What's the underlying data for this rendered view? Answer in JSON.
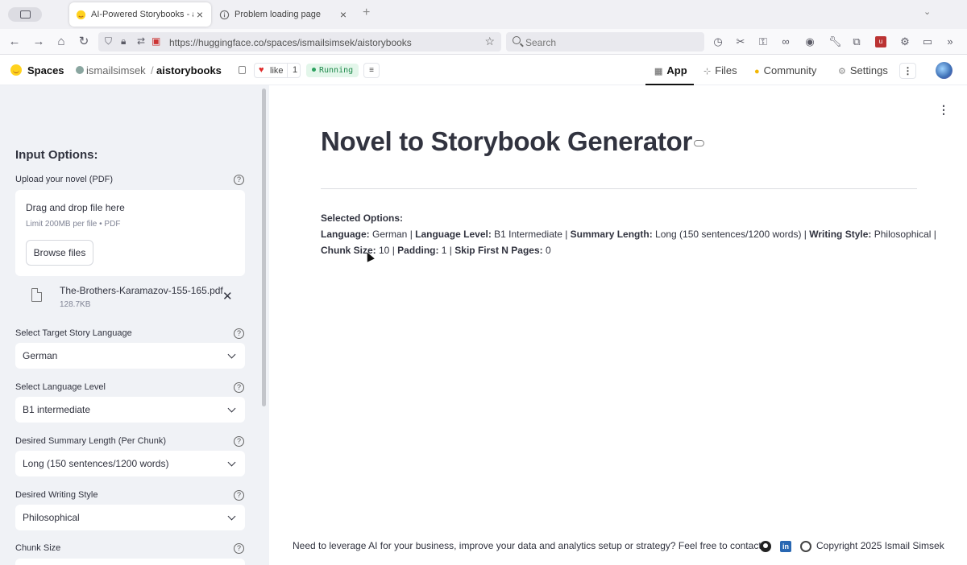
{
  "browser": {
    "tabs": [
      {
        "title": "AI-Powered Storybooks - a Hugg",
        "active": true
      },
      {
        "title": "Problem loading page",
        "active": false
      }
    ],
    "new_tab": "+",
    "url": "https://huggingface.co/spaces/ismailsimsek/aistorybooks",
    "search_placeholder": "Search",
    "icons": [
      "tab-overview-icon",
      "back-icon",
      "forward-icon",
      "home-icon",
      "reload-icon",
      "shield-icon",
      "lock-icon",
      "permissions-icon",
      "bookmark-star-icon",
      "history-icon",
      "screenshot-icon",
      "password-key-icon",
      "reader-mask-icon",
      "account-icon",
      "wrench-icon",
      "extensions-icon",
      "ublock-icon",
      "settings-gear-icon",
      "sidebar-icon",
      "overflow-menu-icon"
    ]
  },
  "hf": {
    "spaces_label": "Spaces",
    "owner": "ismailsimsek",
    "separator": "/",
    "repo": "aistorybooks",
    "like_label": "like",
    "like_count": "1",
    "status": "Running",
    "tabs": [
      {
        "label": "App",
        "icon": "app-icon",
        "active": true
      },
      {
        "label": "Files",
        "icon": "files-icon",
        "active": false
      },
      {
        "label": "Community",
        "icon": "community-icon",
        "active": false
      },
      {
        "label": "Settings",
        "icon": "settings-icon",
        "active": false
      }
    ]
  },
  "sidebar": {
    "heading": "Input Options:",
    "upload": {
      "label": "Upload your novel (PDF)",
      "drag_text": "Drag and drop file here",
      "limit_text": "Limit 200MB per file • PDF",
      "browse_label": "Browse files",
      "file_name": "The-Brothers-Karamazov-155-165.pdf",
      "file_size": "128.7KB"
    },
    "selects": [
      {
        "label": "Select Target Story Language",
        "value": "German"
      },
      {
        "label": "Select Language Level",
        "value": "B1 intermediate"
      },
      {
        "label": "Desired Summary Length (Per Chunk)",
        "value": "Long (150 sentences/1200 words)"
      },
      {
        "label": "Desired Writing Style",
        "value": "Philosophical"
      }
    ],
    "chunk_label": "Chunk Size"
  },
  "main": {
    "title": "Novel to Storybook Generator",
    "selected_heading": "Selected Options:",
    "options": {
      "language_k": "Language:",
      "language_v": " German | ",
      "level_k": "Language Level:",
      "level_v": " B1 Intermediate | ",
      "length_k": "Summary Length:",
      "length_v": " Long (150 sentences/1200 words) | ",
      "style_k": "Writing Style:",
      "style_v": " Philosophical |",
      "chunk_k": "Chunk Size:",
      "chunk_v": " 10 | ",
      "padding_k": "Padding:",
      "padding_v": " 1 | ",
      "skip_k": "Skip First N Pages:",
      "skip_v": " 0"
    },
    "footer_text": "Need to leverage AI for your business, improve your data and analytics setup or strategy? Feel free to contact.",
    "copyright": "Copyright 2025 Ismail Simsek"
  }
}
